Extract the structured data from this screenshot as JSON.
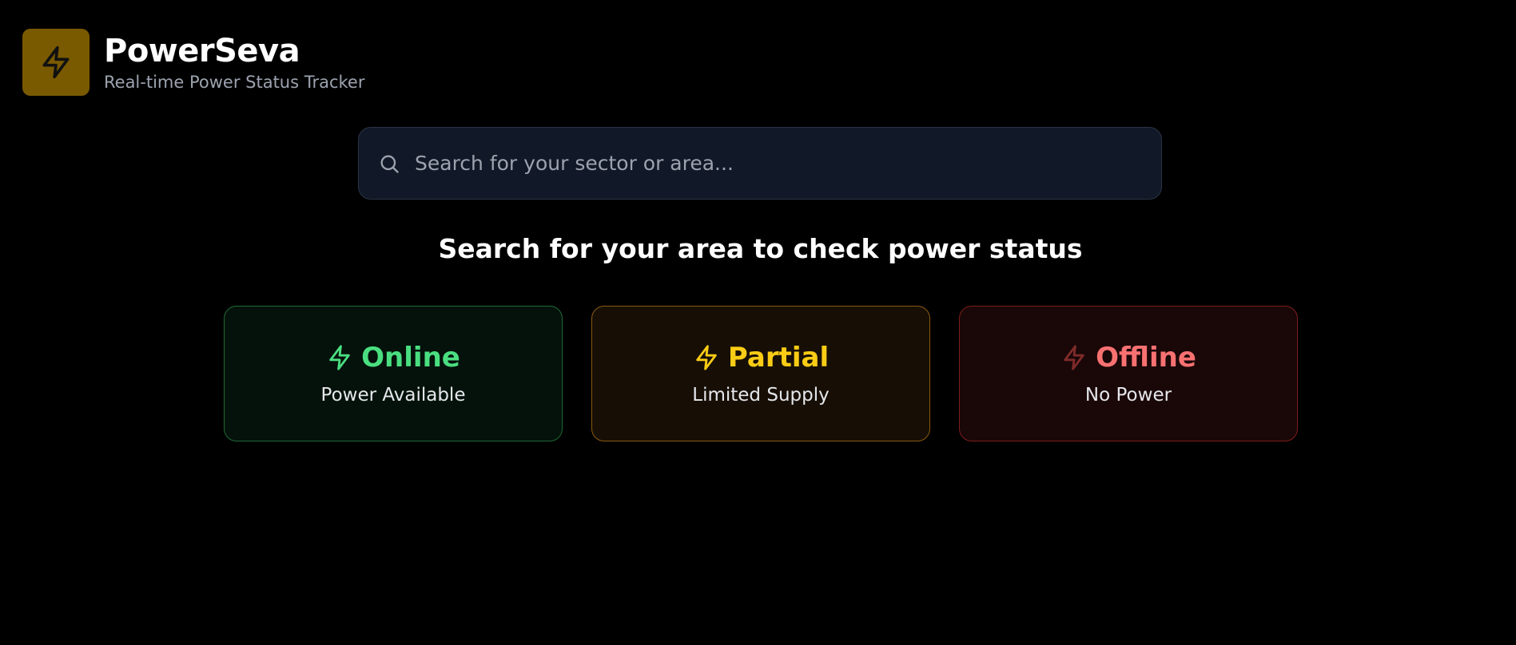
{
  "app": {
    "title": "PowerSeva",
    "subtitle": "Real-time Power Status Tracker",
    "logo_icon": "lightning-bolt-icon",
    "accent": "#7a5a00"
  },
  "search": {
    "placeholder": "Search for your sector or area...",
    "value": "",
    "icon": "search-icon"
  },
  "prompt": "Search for your area to check power status",
  "legend": {
    "online": {
      "label": "Online",
      "description": "Power Available",
      "color": "#4ade80",
      "icon": "lightning-bolt-icon"
    },
    "partial": {
      "label": "Partial",
      "description": "Limited Supply",
      "color": "#facc15",
      "icon": "lightning-bolt-icon"
    },
    "offline": {
      "label": "Offline",
      "description": "No Power",
      "color": "#f87171",
      "icon": "lightning-bolt-off-icon"
    }
  }
}
